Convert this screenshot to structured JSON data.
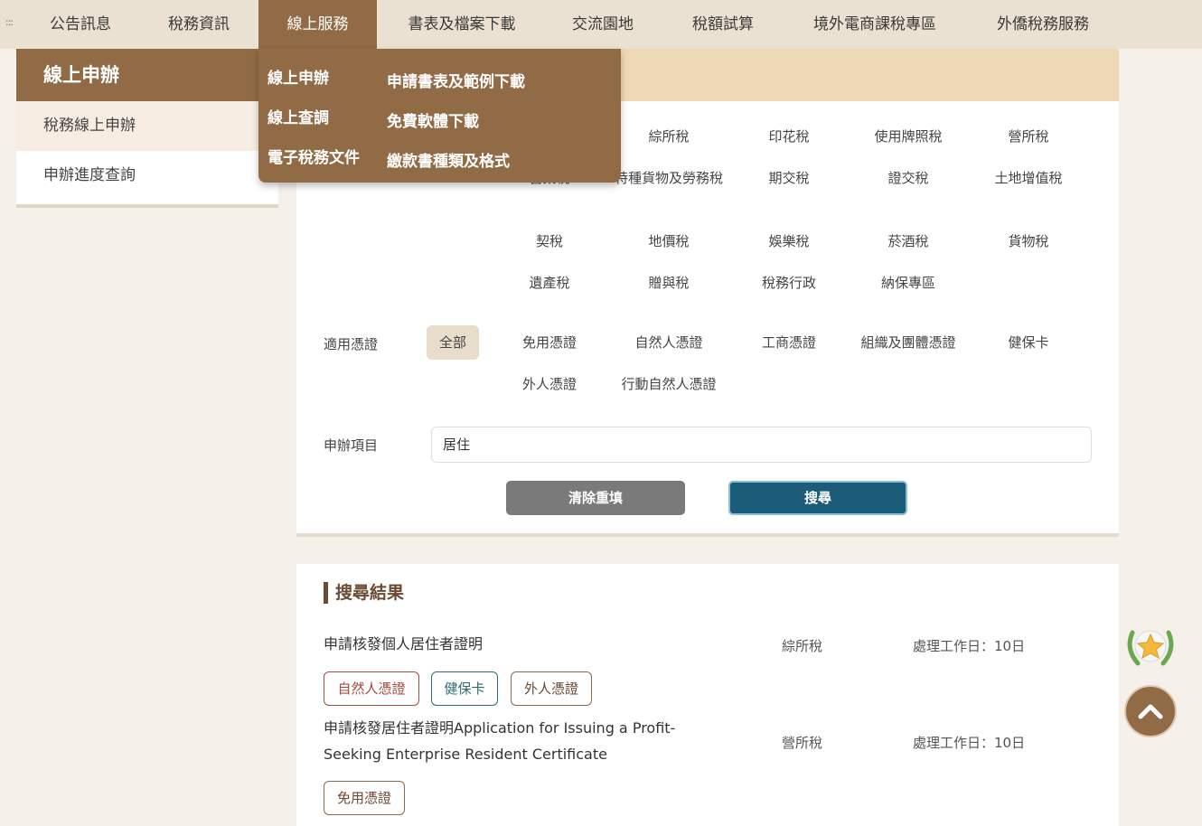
{
  "nav": {
    "grip": ":::",
    "items": [
      "公告訊息",
      "稅務資訊",
      "線上服務",
      "書表及檔案下載",
      "交流園地",
      "稅額試算",
      "境外電商課稅專區",
      "外僑稅務服務"
    ]
  },
  "sidebar": {
    "title": "線上申辦",
    "items": [
      "稅務線上申辦",
      "申辦進度查詢"
    ]
  },
  "dropdown": {
    "col1": [
      "線上申辦",
      "線上查調",
      "電子稅務文件"
    ],
    "col2": [
      "申請書表及範例下載",
      "免費軟體下載",
      "繳款書種類及格式"
    ]
  },
  "filters": {
    "tax_types": [
      "綜所稅",
      "印花稅",
      "使用牌照稅",
      "營所稅",
      "營業稅",
      "特種貨物及勞務稅",
      "期交稅",
      "證交稅",
      "土地增值稅",
      "契稅",
      "地價稅",
      "娛樂稅",
      "菸酒稅",
      "貨物稅",
      "遺產稅",
      "贈與稅",
      "稅務行政",
      "納保專區"
    ],
    "cert_label": "適用憑證",
    "cert_all": "全部",
    "certs": [
      "免用憑證",
      "自然人憑證",
      "工商憑證",
      "組織及團體憑證",
      "健保卡",
      "外人憑證",
      "行動自然人憑證"
    ],
    "item_label": "申辦項目",
    "item_value": "居住",
    "clear_label": "清除重填",
    "search_label": "搜尋"
  },
  "results": {
    "title": "搜尋結果",
    "rows": [
      {
        "name": "申請核發個人居住者證明",
        "tax": "綜所稅",
        "days": "處理工作日：10日",
        "tags": [
          "自然人憑證",
          "健保卡",
          "外人憑證"
        ]
      },
      {
        "name": "申請核發居住者證明Application for Issuing a Profit-Seeking Enterprise Resident Certificate",
        "tax": "營所稅",
        "days": "處理工作日：10日",
        "tags": [
          "免用憑證"
        ]
      }
    ]
  },
  "colors": {
    "brand_brown": "#916b46",
    "search_blue": "#1c5c7a",
    "band_tan": "#eed9b6"
  }
}
